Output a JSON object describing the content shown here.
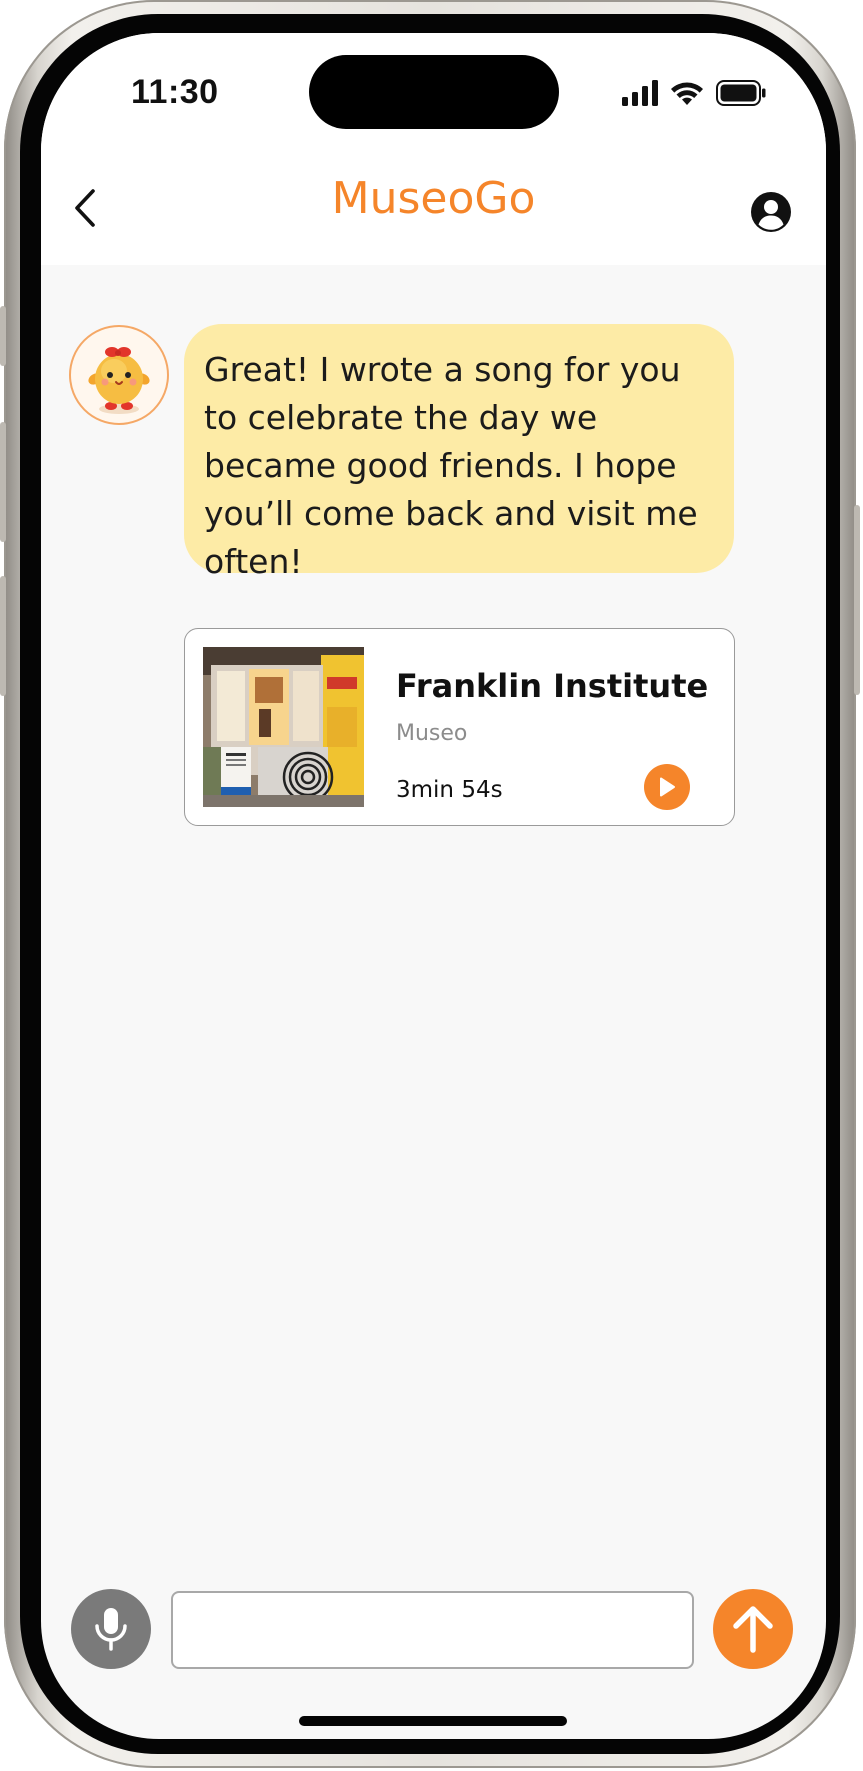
{
  "status_bar": {
    "time": "11:30",
    "icons": [
      "cellular-signal-icon",
      "wifi-icon",
      "battery-icon"
    ]
  },
  "header": {
    "title": "MuseoGo",
    "back_icon": "chevron-left-icon",
    "profile_icon": "user-circle-icon"
  },
  "chat": {
    "bot_avatar": "chick-mascot-avatar",
    "message": "Great! I wrote a song for you to celebrate the day we became good friends. I hope you’ll come back and visit me often!",
    "track": {
      "title": "Franklin Institute",
      "subtitle": "Museo",
      "duration": "3min 54s",
      "play_icon": "play-icon"
    }
  },
  "composer": {
    "input_value": "",
    "input_placeholder": "",
    "mic_icon": "microphone-icon",
    "send_icon": "arrow-up-icon"
  },
  "colors": {
    "brand": "#f5852a",
    "bubble": "#fdeba6",
    "mic_button": "#7a7a7a",
    "background": "#f8f8f8"
  }
}
